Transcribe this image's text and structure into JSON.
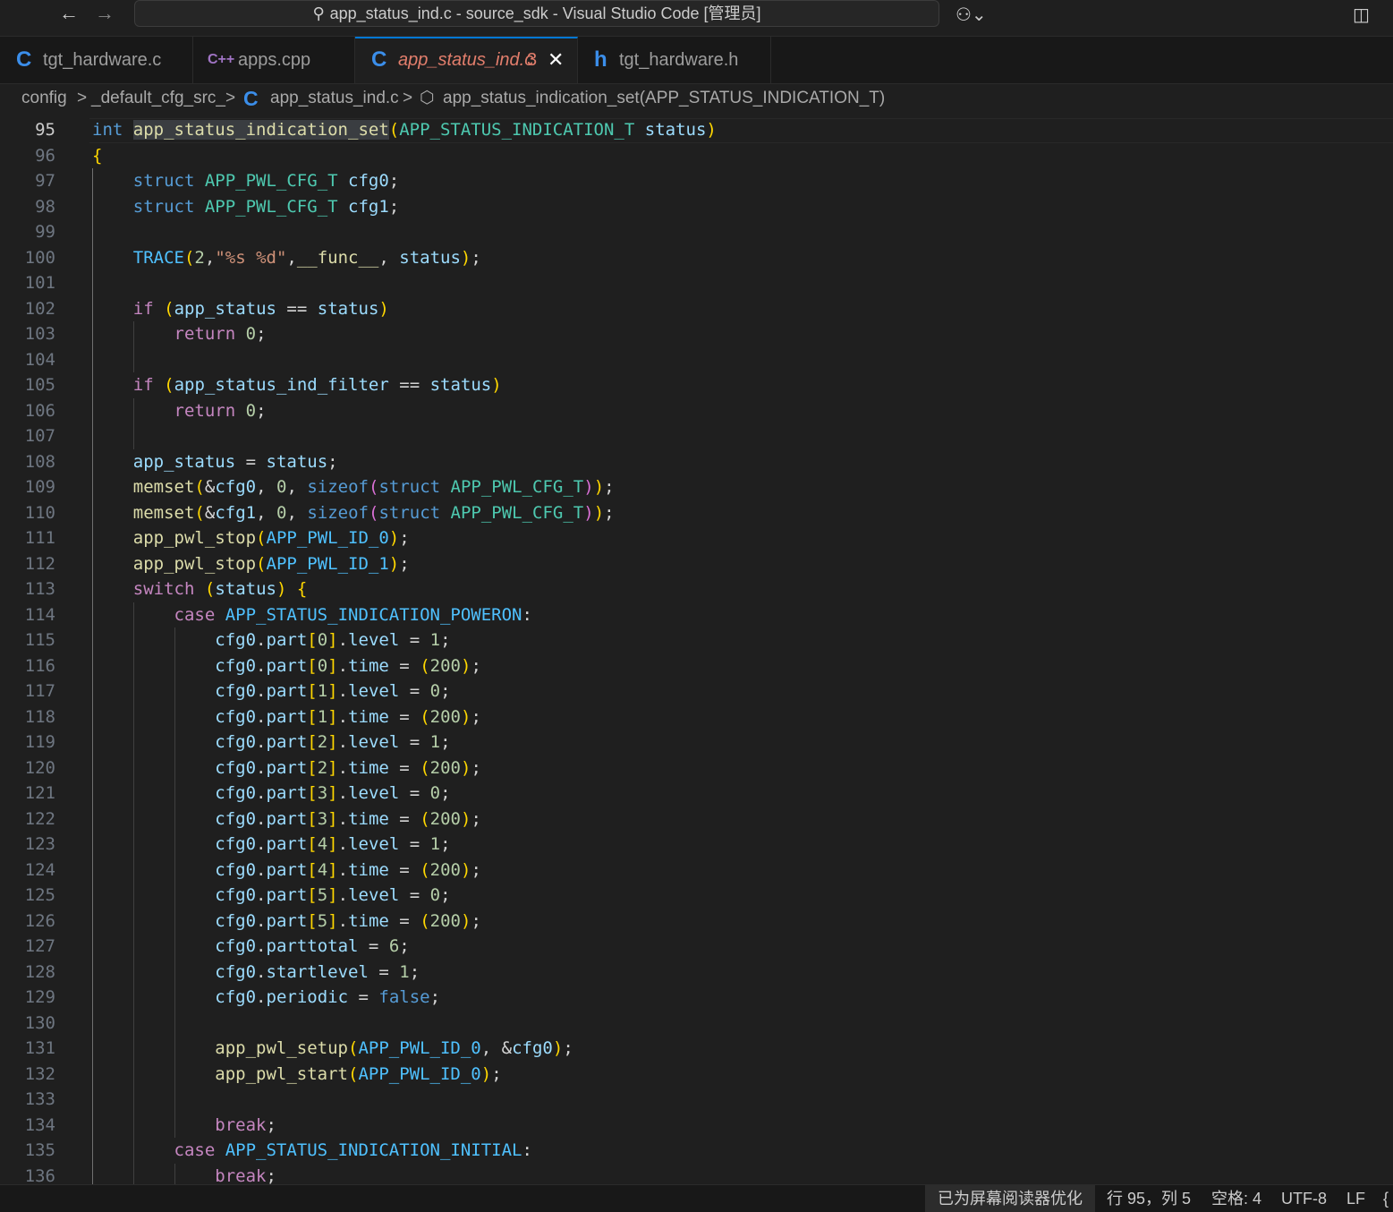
{
  "titlebar": {
    "back": "←",
    "forward": "→",
    "title": "app_status_ind.c - source_sdk - Visual Studio Code [管理员]",
    "search_glyph": "⚲",
    "copilot_glyph": "⚇⌄",
    "layout_glyph": "◫"
  },
  "tabs": [
    {
      "icon": "C",
      "icon_name": "c-file-icon",
      "label": "tgt_hardware.c"
    },
    {
      "icon": "C++",
      "icon_name": "cpp-file-icon",
      "label": "apps.cpp"
    },
    {
      "icon": "C",
      "icon_name": "c-file-icon",
      "label": "app_status_ind.c",
      "badge": "3",
      "close": "✕",
      "active": true
    },
    {
      "icon": "h",
      "icon_name": "header-file-icon",
      "label": "tgt_hardware.h"
    }
  ],
  "breadcrumb": {
    "folder1": "config",
    "folder2": "_default_cfg_src_",
    "file_icon": "C",
    "file": "app_status_ind.c",
    "symbol_icon": "⬡",
    "symbol": "app_status_indication_set(APP_STATUS_INDICATION_T)",
    "sep": ">"
  },
  "editor": {
    "line_numbers": [
      "95",
      "96",
      "97",
      "98",
      "99",
      "100",
      "101",
      "102",
      "103",
      "104",
      "105",
      "106",
      "107",
      "108",
      "109",
      "110",
      "111",
      "112",
      "113",
      "114",
      "115",
      "116",
      "117",
      "118",
      "119",
      "120",
      "121",
      "122",
      "123",
      "124",
      "125",
      "126",
      "127",
      "128",
      "129",
      "130",
      "131",
      "132",
      "133",
      "134",
      "135",
      "136"
    ],
    "lines": [
      "int app_status_indication_set(APP_STATUS_INDICATION_T status)",
      "{",
      "    struct APP_PWL_CFG_T cfg0;",
      "    struct APP_PWL_CFG_T cfg1;",
      "",
      "    TRACE(2,\"%s %d\",__func__, status);",
      "",
      "    if (app_status == status)",
      "        return 0;",
      "",
      "    if (app_status_ind_filter == status)",
      "        return 0;",
      "",
      "    app_status = status;",
      "    memset(&cfg0, 0, sizeof(struct APP_PWL_CFG_T));",
      "    memset(&cfg1, 0, sizeof(struct APP_PWL_CFG_T));",
      "    app_pwl_stop(APP_PWL_ID_0);",
      "    app_pwl_stop(APP_PWL_ID_1);",
      "    switch (status) {",
      "        case APP_STATUS_INDICATION_POWERON:",
      "            cfg0.part[0].level = 1;",
      "            cfg0.part[0].time = (200);",
      "            cfg0.part[1].level = 0;",
      "            cfg0.part[1].time = (200);",
      "            cfg0.part[2].level = 1;",
      "            cfg0.part[2].time = (200);",
      "            cfg0.part[3].level = 0;",
      "            cfg0.part[3].time = (200);",
      "            cfg0.part[4].level = 1;",
      "            cfg0.part[4].time = (200);",
      "            cfg0.part[5].level = 0;",
      "            cfg0.part[5].time = (200);",
      "            cfg0.parttotal = 6;",
      "            cfg0.startlevel = 1;",
      "            cfg0.periodic = false;",
      "",
      "            app_pwl_setup(APP_PWL_ID_0, &cfg0);",
      "            app_pwl_start(APP_PWL_ID_0);",
      "",
      "            break;",
      "        case APP_STATUS_INDICATION_INITIAL:",
      "            break;"
    ]
  },
  "statusbar": {
    "screen_reader": "已为屏幕阅读器优化",
    "cursor": "行 95，列 5",
    "indent": "空格: 4",
    "encoding": "UTF-8",
    "eol": "LF",
    "lang_glyph": "{"
  },
  "colors": {
    "accent": "#0078d4",
    "editor_bg": "#1f1f1f",
    "modified_tab": "#e27e6c"
  }
}
